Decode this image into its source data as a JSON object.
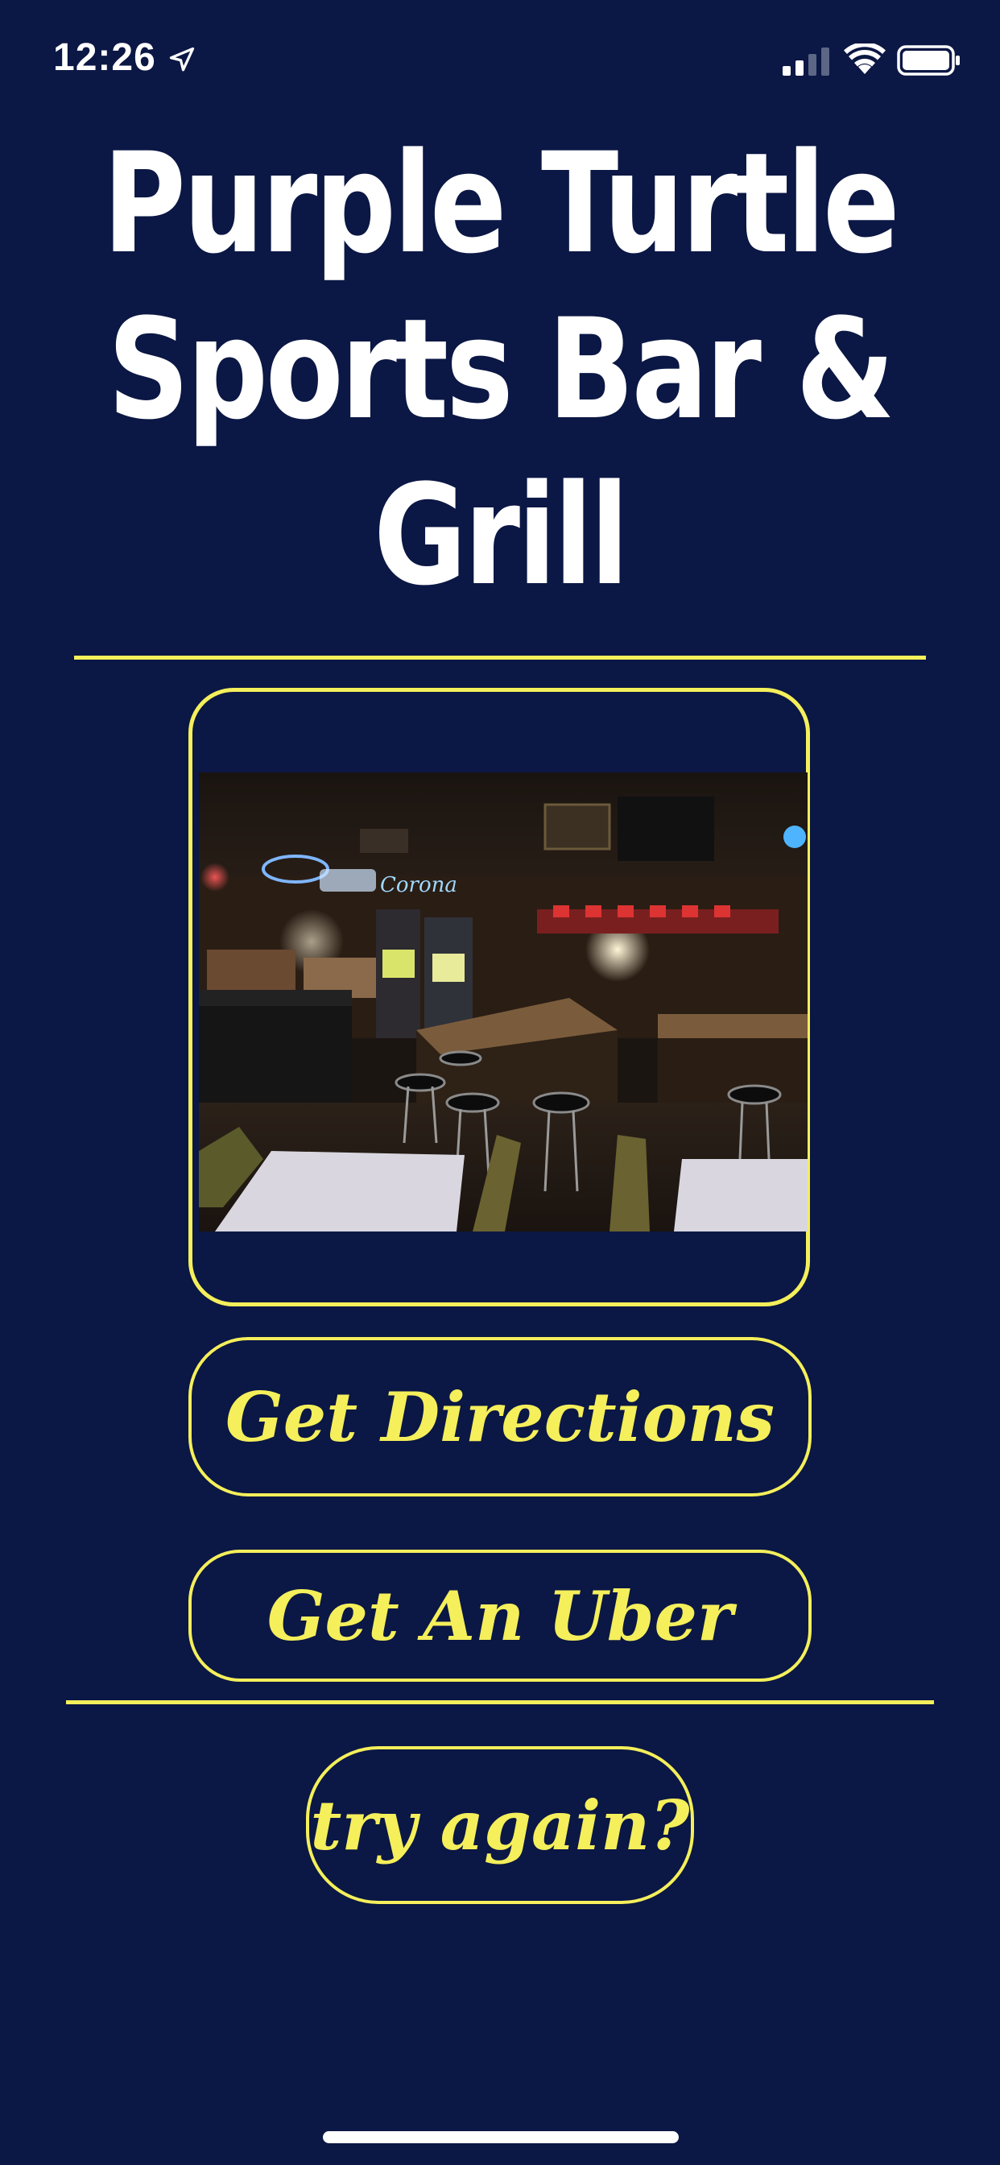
{
  "status_bar": {
    "time": "12:26",
    "icons": [
      "location-arrow-icon",
      "cellular-signal-icon",
      "wifi-icon",
      "battery-icon"
    ]
  },
  "title": {
    "lines": [
      "Purple Turtle",
      "Sports Bar &",
      "Grill"
    ]
  },
  "photo": {
    "subject": "bar-interior-photo",
    "neon_sign_text": "Corona"
  },
  "buttons": {
    "directions": "Get Directions",
    "uber": "Get An Uber",
    "retry": "try again?"
  },
  "colors": {
    "background": "#0b1744",
    "accent": "#f4ef5b",
    "text": "#ffffff"
  }
}
